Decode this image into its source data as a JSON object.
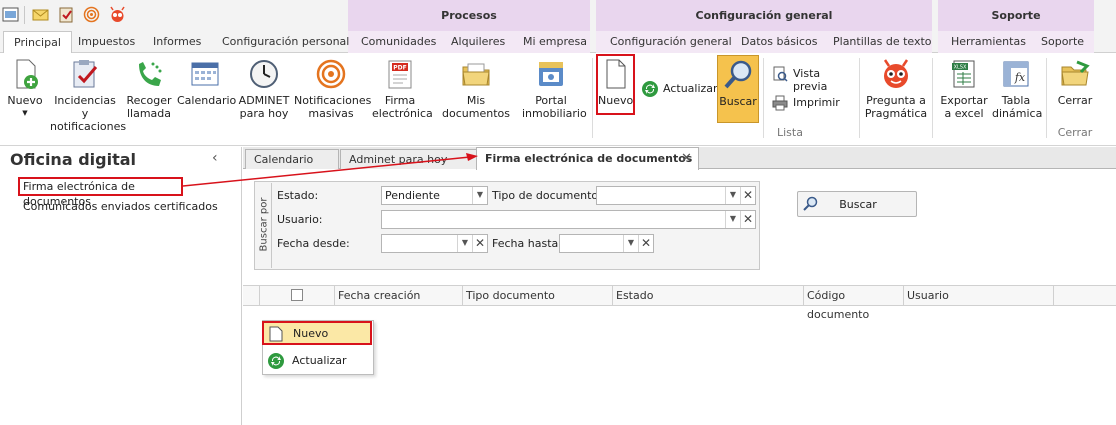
{
  "ribbon_groups": {
    "procesos": "Procesos",
    "configuracion_general": "Configuración general",
    "soporte": "Soporte"
  },
  "tabs": [
    "Principal",
    "Impuestos",
    "Informes",
    "Configuración personal",
    "Comunidades",
    "Alquileres",
    "Mi empresa",
    "Configuración general",
    "Datos básicos",
    "Plantillas de texto",
    "Herramientas",
    "Soporte"
  ],
  "ribbon": {
    "nuevo": "Nuevo",
    "incidencias": [
      "Incidencias y",
      "notificaciones"
    ],
    "recoger": [
      "Recoger",
      "llamada"
    ],
    "calendario": "Calendario",
    "adminet": [
      "ADMINET",
      "para hoy"
    ],
    "notificaciones": [
      "Notificaciones",
      "masivas"
    ],
    "firma": [
      "Firma",
      "electrónica"
    ],
    "mis_documentos": "Mis documentos",
    "portal": [
      "Portal",
      "inmobiliario"
    ],
    "nuevo2": "Nuevo",
    "actualizar": "Actualizar",
    "buscar": "Buscar",
    "vista_previa": "Vista previa",
    "imprimir": "Imprimir",
    "pregunta": [
      "Pregunta a",
      "Pragmática"
    ],
    "exportar": [
      "Exportar",
      "a excel"
    ],
    "tabla": [
      "Tabla",
      "dinámica"
    ],
    "cerrar": "Cerrar",
    "grp_lista": "Lista",
    "grp_cerrar": "Cerrar"
  },
  "left_panel": {
    "title": "Oficina digital",
    "items": [
      "Firma electrónica de documentos",
      "Comunicados enviados certificados"
    ]
  },
  "doc_tabs": [
    "Calendario",
    "Adminet para hoy",
    "Firma electrónica de documentos"
  ],
  "filter": {
    "side_label": "Buscar por",
    "estado_label": "Estado:",
    "estado_value": "Pendiente",
    "tipo_label": "Tipo de documento:",
    "usuario_label": "Usuario:",
    "fecha_desde_label": "Fecha desde:",
    "fecha_hasta_label": "Fecha hasta:",
    "buscar_button": "Buscar"
  },
  "grid": {
    "columns": [
      "Fecha creación",
      "Tipo documento",
      "Estado",
      "Código documento",
      "Usuario"
    ]
  },
  "context_menu": [
    "Nuevo",
    "Actualizar"
  ],
  "colors": {
    "highlight": "#d8121b",
    "context_group": "#e9d6ee",
    "accent_orange": "#f5c24d"
  }
}
